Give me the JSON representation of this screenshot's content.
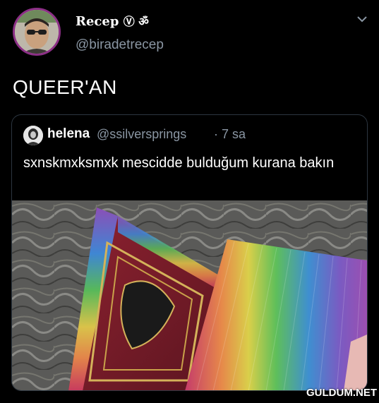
{
  "tweet": {
    "display_name": "Recep",
    "name_symbols": "Ⓥ ॐ",
    "handle": "@biradetrecep",
    "text": "QUEER'AN",
    "menu_icon": "chevron-down-icon"
  },
  "quote": {
    "display_name": "helena",
    "handle": "@ssilversprings",
    "time": "· 7 sa",
    "text": "sxnskmxksmxk mescidde bulduğum kurana bakın"
  },
  "watermark": "GULDUM.NET",
  "colors": {
    "background": "#000000",
    "secondary_text": "#8a96a3",
    "card_border": "#2c3640",
    "avatar_ring": "#8c2f86"
  }
}
